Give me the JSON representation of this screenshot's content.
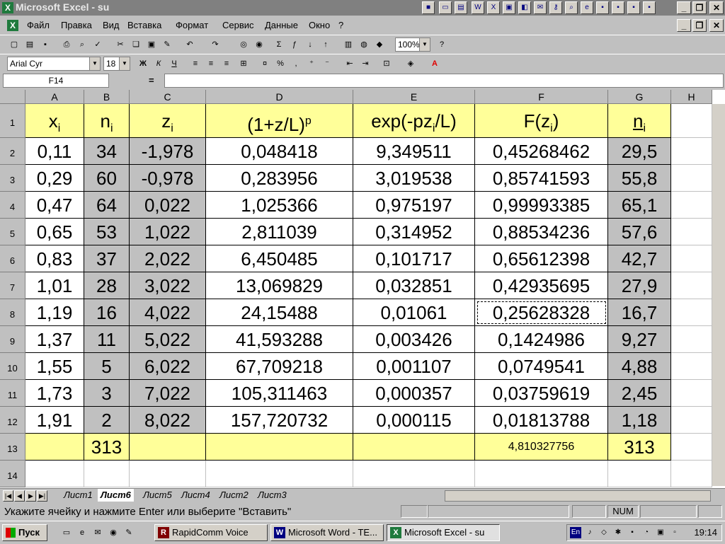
{
  "window": {
    "title": "Microsoft Excel - su"
  },
  "menu": [
    "Файл",
    "Правка",
    "Вид",
    "Вставка",
    "Формат",
    "Сервис",
    "Данные",
    "Окно",
    "?"
  ],
  "format_toolbar": {
    "font": "Arial Cyr",
    "size": "18",
    "zoom": "100%"
  },
  "formula_bar": {
    "cell_ref": "F14",
    "equals": "=",
    "value": ""
  },
  "columns": [
    "A",
    "B",
    "C",
    "D",
    "E",
    "F",
    "G",
    "H"
  ],
  "rows": [
    "1",
    "2",
    "3",
    "4",
    "5",
    "6",
    "7",
    "8",
    "9",
    "10",
    "11",
    "12",
    "13",
    "14"
  ],
  "headers": {
    "a": {
      "base": "x",
      "sub": "i"
    },
    "b": {
      "base": "n",
      "sub": "i"
    },
    "c": {
      "base": "z",
      "sub": "i"
    },
    "d": {
      "base": "(1+z/L)",
      "sup": "p"
    },
    "e": {
      "pre": "exp(-pz",
      "sub": "i",
      "post": "/L)"
    },
    "f": {
      "pre": "F(z",
      "sub": "i",
      "post": ")"
    },
    "g": {
      "base": "n",
      "sub": "i"
    }
  },
  "data": [
    [
      "0,11",
      "34",
      "-1,978",
      "0,048418",
      "9,349511",
      "0,45268462",
      "29,5"
    ],
    [
      "0,29",
      "60",
      "-0,978",
      "0,283956",
      "3,019538",
      "0,85741593",
      "55,8"
    ],
    [
      "0,47",
      "64",
      "0,022",
      "1,025366",
      "0,975197",
      "0,99993385",
      "65,1"
    ],
    [
      "0,65",
      "53",
      "1,022",
      "2,811039",
      "0,314952",
      "0,88534236",
      "57,6"
    ],
    [
      "0,83",
      "37",
      "2,022",
      "6,450485",
      "0,101717",
      "0,65612398",
      "42,7"
    ],
    [
      "1,01",
      "28",
      "3,022",
      "13,069829",
      "0,032851",
      "0,42935695",
      "27,9"
    ],
    [
      "1,19",
      "16",
      "4,022",
      "24,15488",
      "0,01061",
      "0,25628328",
      "16,7"
    ],
    [
      "1,37",
      "11",
      "5,022",
      "41,593288",
      "0,003426",
      "0,1424986",
      "9,27"
    ],
    [
      "1,55",
      "5",
      "6,022",
      "67,709218",
      "0,001107",
      "0,0749541",
      "4,88"
    ],
    [
      "1,73",
      "3",
      "7,022",
      "105,311463",
      "0,000357",
      "0,03759619",
      "2,45"
    ],
    [
      "1,91",
      "2",
      "8,022",
      "157,720732",
      "0,000115",
      "0,01813788",
      "1,18"
    ]
  ],
  "totals": {
    "b": "313",
    "f": "4,810327756",
    "g": "313"
  },
  "sheets": [
    "Лист1",
    "Лист6",
    "Лист5",
    "Лист4",
    "Лист2",
    "Лист3"
  ],
  "active_sheet": "Лист6",
  "status": {
    "message": "Укажите ячейку и нажмите Enter или выберите \"Вставить\"",
    "num": "NUM"
  },
  "taskbar": {
    "start": "Пуск",
    "buttons": [
      "RapidComm Voice",
      "Microsoft Word - TE...",
      "Microsoft Excel - su"
    ],
    "lang": "En",
    "clock": "19:14"
  }
}
